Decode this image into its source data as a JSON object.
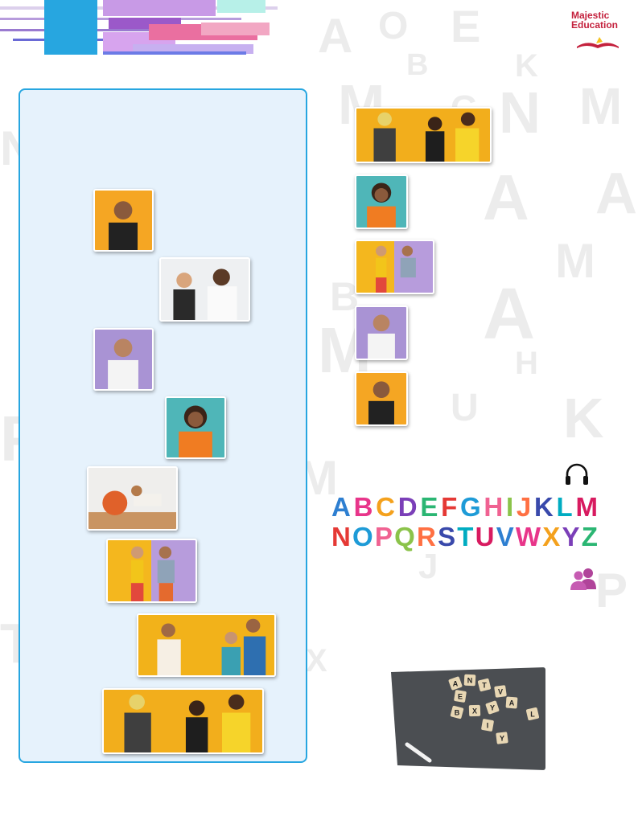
{
  "publisher": {
    "name_line1": "Majestic",
    "name_line2": "Education",
    "brand_color": "#c4213d"
  },
  "icons": {
    "listen": "headphones-icon",
    "pairwork": "two-people-icon"
  },
  "alphabet": {
    "row1": [
      "A",
      "B",
      "C",
      "D",
      "E",
      "F",
      "G",
      "H",
      "I",
      "J",
      "K",
      "L",
      "M"
    ],
    "row2": [
      "N",
      "O",
      "P",
      "Q",
      "R",
      "S",
      "T",
      "U",
      "V",
      "W",
      "X",
      "Y",
      "Z"
    ],
    "colors": [
      "#2e7fd1",
      "#e8358a",
      "#f4a11d",
      "#7b3fb8",
      "#2bb673",
      "#e53935",
      "#1e9bd7",
      "#f06292",
      "#8bc34a",
      "#ff7043",
      "#3949ab",
      "#00acc1",
      "#d81b60"
    ]
  },
  "dice_letters": [
    "A",
    "N",
    "T",
    "E",
    "V",
    "B",
    "X",
    "Y",
    "A",
    "L",
    "I",
    "Y"
  ],
  "colors": {
    "panel_bg": "#e6f2fc",
    "panel_border": "#27a6e0"
  }
}
